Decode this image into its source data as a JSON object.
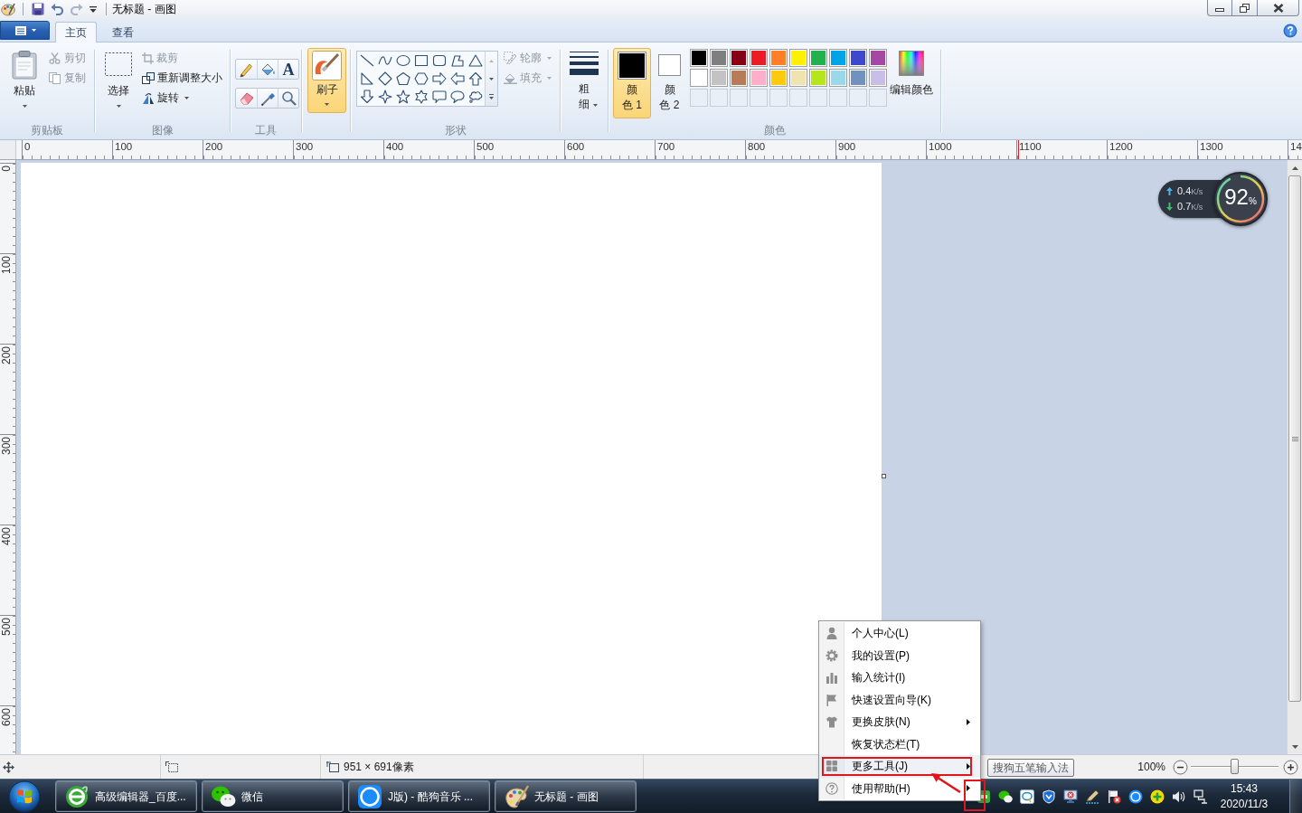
{
  "window": {
    "title": "无标题 - 画图"
  },
  "ribbon": {
    "tabs": [
      {
        "label": "主页",
        "selected": true
      },
      {
        "label": "查看",
        "selected": false
      }
    ],
    "clipboard": {
      "label": "剪贴板",
      "paste": "粘贴",
      "actions": [
        {
          "label": "剪切",
          "disabled": true
        },
        {
          "label": "复制",
          "disabled": true
        }
      ]
    },
    "image": {
      "label": "图像",
      "select": "选择",
      "actions": [
        {
          "label": "裁剪",
          "disabled": true,
          "dropdown": false
        },
        {
          "label": "重新调整大小",
          "disabled": false,
          "dropdown": false
        },
        {
          "label": "旋转",
          "disabled": false,
          "dropdown": true
        }
      ]
    },
    "tools": {
      "label": "工具",
      "text_tool": "A"
    },
    "brushes": {
      "label": "刷子",
      "selected": true
    },
    "shapes": {
      "label": "形状",
      "options": [
        {
          "label": "轮廓",
          "disabled": true
        },
        {
          "label": "填充",
          "disabled": true
        }
      ]
    },
    "size": {
      "label": "粗细"
    },
    "colors": {
      "label": "颜色",
      "active": [
        {
          "label": "颜色 1",
          "color": "#000000",
          "selected": true
        },
        {
          "label": "颜色 2",
          "color": "#ffffff",
          "selected": false
        }
      ],
      "palette": [
        {
          "color": "#000000"
        },
        {
          "color": "#7f7f7f"
        },
        {
          "color": "#880015"
        },
        {
          "color": "#ed1c24"
        },
        {
          "color": "#ff7f27"
        },
        {
          "color": "#fff200"
        },
        {
          "color": "#22b14c"
        },
        {
          "color": "#00a2e8"
        },
        {
          "color": "#3f48cc"
        },
        {
          "color": "#a349a4"
        },
        {
          "color": "#ffffff"
        },
        {
          "color": "#c3c3c3"
        },
        {
          "color": "#b97a57"
        },
        {
          "color": "#ffaec9"
        },
        {
          "color": "#ffc90e"
        },
        {
          "color": "#efe4b0"
        },
        {
          "color": "#b5e61d"
        },
        {
          "color": "#99d9ea"
        },
        {
          "color": "#7092be"
        },
        {
          "color": "#c8bfe7"
        }
      ],
      "edit": "编辑颜色"
    }
  },
  "rulers": {
    "horizontal": [
      "0",
      "100",
      "200",
      "300",
      "400",
      "500",
      "600",
      "700",
      "800",
      "900",
      "1000",
      "1100",
      "1200",
      "1300",
      "14"
    ],
    "vertical": [
      "0",
      "100",
      "200",
      "300",
      "400",
      "500",
      "600"
    ]
  },
  "network_monitor": {
    "upload": {
      "value": "0.4",
      "unit": "K/s"
    },
    "download": {
      "value": "0.7",
      "unit": "K/s"
    },
    "usage": {
      "value": "92",
      "unit": "%",
      "level": 0.92
    }
  },
  "status_bar": {
    "canvas_size": "951 × 691像素",
    "zoom": {
      "label": "100%",
      "level": 0.5
    }
  },
  "context_menu": {
    "items": [
      {
        "label": "个人中心(L)",
        "submenu": false,
        "selected": false
      },
      {
        "label": "我的设置(P)",
        "submenu": false,
        "selected": false
      },
      {
        "label": "输入统计(I)",
        "submenu": false,
        "selected": false
      },
      {
        "label": "快速设置向导(K)",
        "submenu": false,
        "selected": false
      },
      {
        "label": "更换皮肤(N)",
        "submenu": true,
        "selected": false
      },
      {
        "label": "恢复状态栏(T)",
        "submenu": false,
        "selected": false
      },
      {
        "label": "更多工具(J)",
        "submenu": true,
        "selected": true
      },
      {
        "label": "使用帮助(H)",
        "submenu": true,
        "selected": false
      }
    ]
  },
  "tooltip": {
    "text": "搜狗五笔输入法"
  },
  "taskbar": {
    "items": [
      {
        "label": "高级编辑器_百度..."
      },
      {
        "label": "微信"
      },
      {
        "label": "J版) - 酷狗音乐 ..."
      },
      {
        "label": "无标题 - 画图"
      }
    ],
    "clock": {
      "time": "15:43",
      "date": "2020/11/3"
    }
  },
  "annotations": [
    {
      "kind": "box"
    },
    {
      "kind": "arrow"
    },
    {
      "kind": "box"
    }
  ]
}
